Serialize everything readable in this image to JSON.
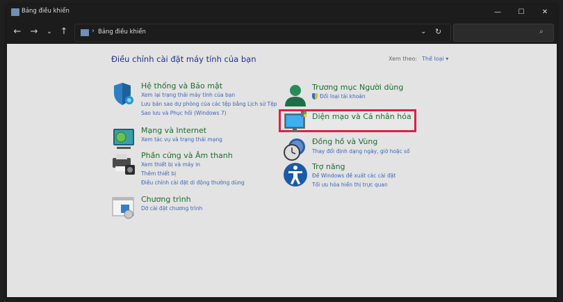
{
  "window": {
    "title": "Bảng điều khiển",
    "controls": {
      "minimize": "—",
      "maximize": "☐",
      "close": "✕"
    }
  },
  "nav": {
    "back": "←",
    "forward": "→",
    "recent": "⌄",
    "up": "↑",
    "breadcrumb_sep": "›",
    "path": "Bảng điều khiển",
    "dropdown": "⌄",
    "refresh": "↻"
  },
  "search": {
    "value": "",
    "placeholder": "",
    "icon": "⌕"
  },
  "main": {
    "heading": "Điều chỉnh cài đặt máy tính của bạn",
    "view_by_label": "Xem theo:",
    "view_by_value": "Thể loại ▾",
    "left": [
      {
        "title": "Hệ thống và Bảo mật",
        "icon": "shield-icon",
        "links": [
          "Xem lại trạng thái máy tính của bạn",
          "Lưu bản sao dự phòng của các tệp bằng Lịch sử Tệp",
          "Sao lưu và Phục hồi (Windows 7)"
        ]
      },
      {
        "title": "Mạng và Internet",
        "icon": "network-icon",
        "links": [
          "Xem tác vụ và trạng thái mạng"
        ]
      },
      {
        "title": "Phần cứng và Âm thanh",
        "icon": "printer-icon",
        "links": [
          "Xem thiết bị và máy in",
          "Thêm thiết bị",
          "Điều chỉnh cài đặt di động thường dùng"
        ]
      },
      {
        "title": "Chương trình",
        "icon": "programs-icon",
        "links": [
          "Dỡ cài đặt chương trình"
        ]
      }
    ],
    "right": [
      {
        "title": "Trương mục Người dùng",
        "icon": "user-icon",
        "links": [
          "Đổi loại tài khoản"
        ]
      },
      {
        "title": "Diện mạo và Cá nhân hóa",
        "icon": "appearance-icon",
        "links": []
      },
      {
        "title": "Đồng hồ và Vùng",
        "icon": "clock-icon",
        "links": [
          "Thay đổi định dạng ngày, giờ hoặc số"
        ]
      },
      {
        "title": "Trợ năng",
        "icon": "accessibility-icon",
        "links": [
          "Để Windows đề xuất các cài đặt",
          "Tối ưu hóa hiển thị trực quan"
        ]
      }
    ]
  },
  "colors": {
    "title_green": "#1e6b2e",
    "link_blue": "#3f64b4",
    "heading_blue": "#1e3287",
    "highlight_red": "#e01e46",
    "content_bg": "#e3e3e3",
    "chrome_bg": "#1c1c1c"
  }
}
